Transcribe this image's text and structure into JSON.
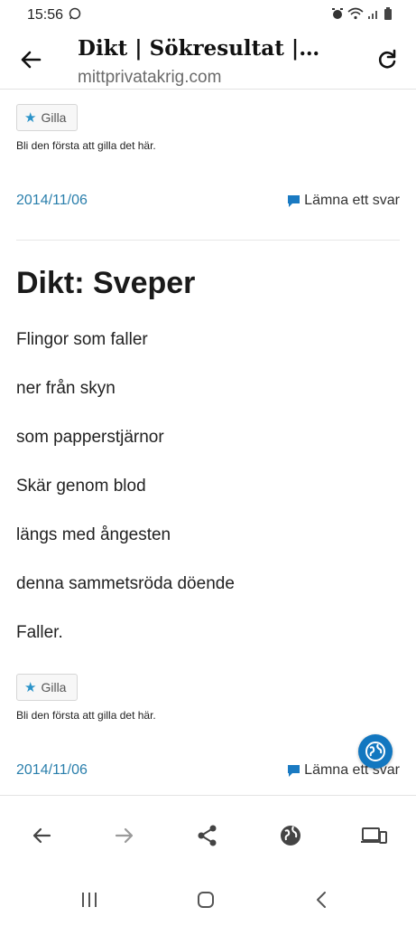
{
  "status": {
    "time": "15:56"
  },
  "header": {
    "title": "Dikt | Sökresultat |…",
    "url": "mittprivatakrig.com"
  },
  "top_post": {
    "like_label": "Gilla",
    "like_text": "Bli den första att gilla det här.",
    "date": "2014/11/06",
    "reply_label": "Lämna ett svar"
  },
  "post": {
    "title": "Dikt: Sveper",
    "lines": [
      "Flingor som faller",
      "ner från skyn",
      "som papperstjärnor",
      "Skär genom blod",
      "längs med ångesten",
      "denna sammetsröda döende",
      "Faller."
    ],
    "like_label": "Gilla",
    "like_text": "Bli den första att gilla det här.",
    "date": "2014/11/06",
    "reply_label": "Lämna ett svar"
  },
  "colors": {
    "link": "#2a7fac",
    "accent": "#1277c0",
    "star": "#2a93c9"
  },
  "icons": [
    "whatsapp-icon",
    "alarm-icon",
    "wifi-icon",
    "signal-icon",
    "battery-icon",
    "back-arrow-icon",
    "reload-icon",
    "star-icon",
    "comment-icon",
    "globe-icon",
    "share-icon",
    "devices-icon",
    "recents-icon",
    "home-icon",
    "system-back-icon"
  ]
}
